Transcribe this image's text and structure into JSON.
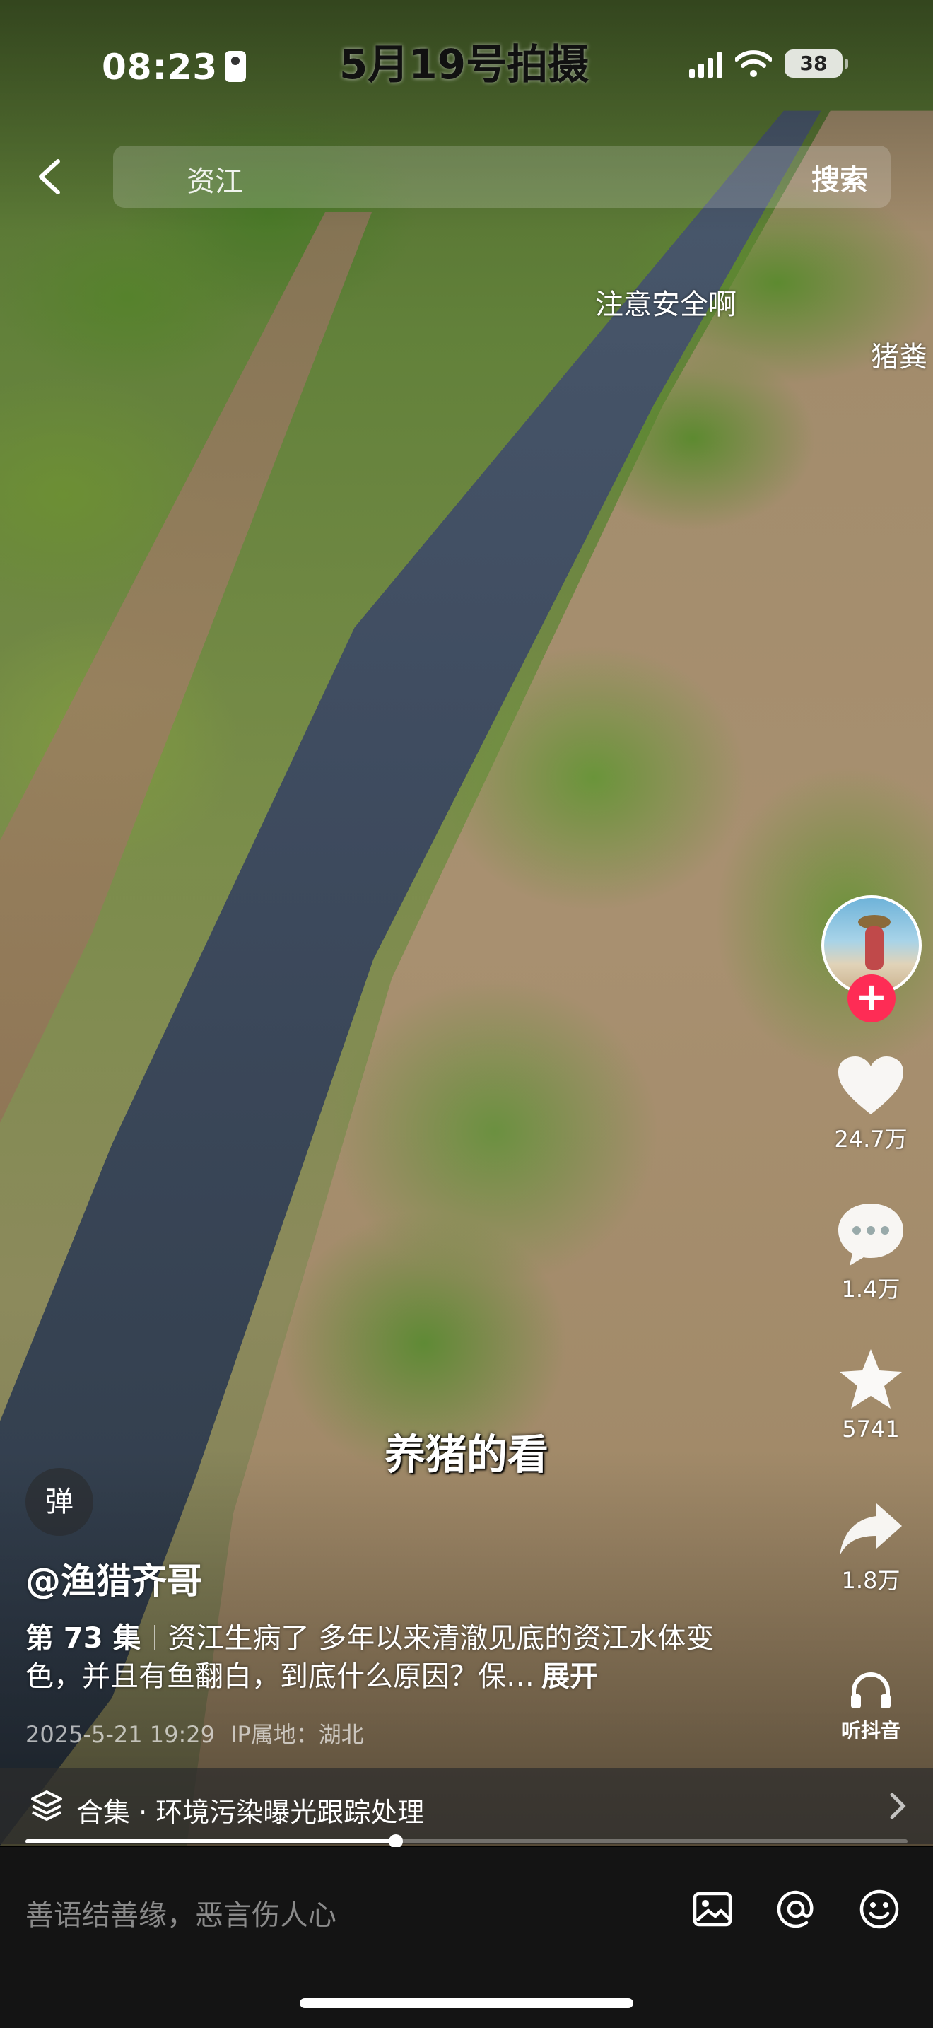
{
  "status_bar": {
    "time": "08:23",
    "battery": "38"
  },
  "video": {
    "date_caption": "5月19号拍摄",
    "danmaku": [
      "注意安全啊",
      "猪粪"
    ],
    "subtitle": "养猪的看"
  },
  "search_bar": {
    "query": "资江",
    "search_label": "搜索"
  },
  "actions": {
    "likes": "24.7万",
    "comments": "1.4万",
    "favorites": "5741",
    "shares": "1.8万",
    "listen_label": "听抖音"
  },
  "post": {
    "danmaku_toggle": "弹",
    "author": "@渔猎齐哥",
    "episode": "第 73 集",
    "description": "资江生病了 多年以来清澈见底的资江水体变色，并且有鱼翻白，到底什么原因？保…",
    "expand_label": "展开",
    "timestamp": "2025-5-21 19:29",
    "ip_label": "IP属地：湖北"
  },
  "collection": {
    "label": "合集 · 环境污染曝光跟踪处理"
  },
  "playback": {
    "progress": 0.42
  },
  "comment_bar": {
    "placeholder": "善语结善缘，恶言伤人心"
  },
  "colors": {
    "accent": "#fe2c55",
    "comment_bg": "#141414"
  }
}
